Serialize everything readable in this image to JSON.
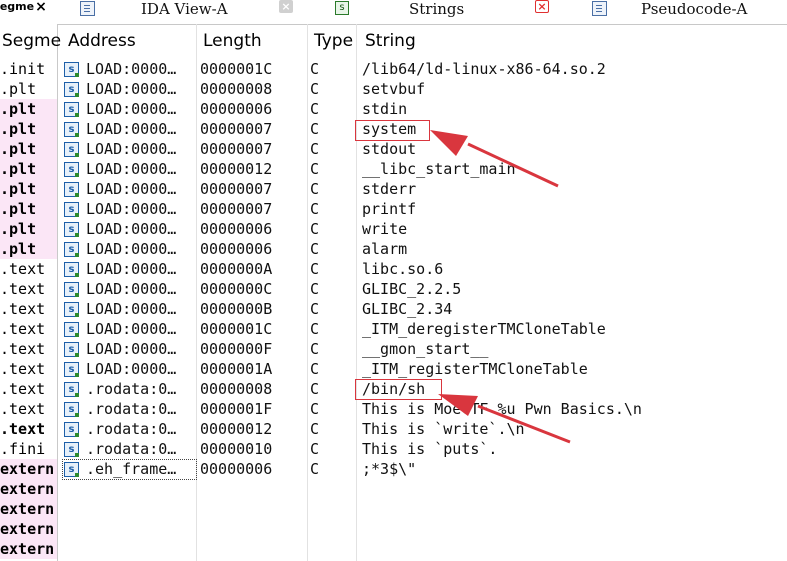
{
  "tabs": [
    {
      "label": "IDA View-A",
      "close": "×"
    },
    {
      "label": "Strings",
      "close": "×"
    },
    {
      "label": "Pseudocode-A",
      "close": ""
    }
  ],
  "left_close": "×",
  "segments_header": "Segme",
  "segments": [
    {
      "label": ".init",
      "hl": false,
      "bold": false
    },
    {
      "label": ".plt",
      "hl": false,
      "bold": false
    },
    {
      "label": ".plt",
      "hl": true,
      "bold": true
    },
    {
      "label": ".plt",
      "hl": true,
      "bold": true
    },
    {
      "label": ".plt",
      "hl": true,
      "bold": true
    },
    {
      "label": ".plt",
      "hl": true,
      "bold": true
    },
    {
      "label": ".plt",
      "hl": true,
      "bold": true
    },
    {
      "label": ".plt",
      "hl": true,
      "bold": true
    },
    {
      "label": ".plt",
      "hl": true,
      "bold": true
    },
    {
      "label": ".plt",
      "hl": true,
      "bold": true
    },
    {
      "label": ".text",
      "hl": false,
      "bold": false
    },
    {
      "label": ".text",
      "hl": false,
      "bold": false
    },
    {
      "label": ".text",
      "hl": false,
      "bold": false
    },
    {
      "label": ".text",
      "hl": false,
      "bold": false
    },
    {
      "label": ".text",
      "hl": false,
      "bold": false
    },
    {
      "label": ".text",
      "hl": false,
      "bold": false
    },
    {
      "label": ".text",
      "hl": false,
      "bold": false
    },
    {
      "label": ".text",
      "hl": false,
      "bold": false
    },
    {
      "label": ".text",
      "hl": false,
      "bold": true
    },
    {
      "label": ".fini",
      "hl": false,
      "bold": false
    },
    {
      "label": "extern",
      "hl": true,
      "bold": true
    },
    {
      "label": "extern",
      "hl": true,
      "bold": true
    },
    {
      "label": "extern",
      "hl": true,
      "bold": true
    },
    {
      "label": "extern",
      "hl": true,
      "bold": true
    },
    {
      "label": "extern",
      "hl": true,
      "bold": true
    }
  ],
  "columns": {
    "address": "Address",
    "length": "Length",
    "type": "Type",
    "string": "String"
  },
  "rows": [
    {
      "address": "LOAD:0000…",
      "length": "0000001C",
      "type": "C",
      "string": "/lib64/ld-linux-x86-64.so.2"
    },
    {
      "address": "LOAD:0000…",
      "length": "00000008",
      "type": "C",
      "string": "setvbuf"
    },
    {
      "address": "LOAD:0000…",
      "length": "00000006",
      "type": "C",
      "string": "stdin"
    },
    {
      "address": "LOAD:0000…",
      "length": "00000007",
      "type": "C",
      "string": "system"
    },
    {
      "address": "LOAD:0000…",
      "length": "00000007",
      "type": "C",
      "string": "stdout"
    },
    {
      "address": "LOAD:0000…",
      "length": "00000012",
      "type": "C",
      "string": "__libc_start_main"
    },
    {
      "address": "LOAD:0000…",
      "length": "00000007",
      "type": "C",
      "string": "stderr"
    },
    {
      "address": "LOAD:0000…",
      "length": "00000007",
      "type": "C",
      "string": "printf"
    },
    {
      "address": "LOAD:0000…",
      "length": "00000006",
      "type": "C",
      "string": "write"
    },
    {
      "address": "LOAD:0000…",
      "length": "00000006",
      "type": "C",
      "string": "alarm"
    },
    {
      "address": "LOAD:0000…",
      "length": "0000000A",
      "type": "C",
      "string": "libc.so.6"
    },
    {
      "address": "LOAD:0000…",
      "length": "0000000C",
      "type": "C",
      "string": "GLIBC_2.2.5"
    },
    {
      "address": "LOAD:0000…",
      "length": "0000000B",
      "type": "C",
      "string": "GLIBC_2.34"
    },
    {
      "address": "LOAD:0000…",
      "length": "0000001C",
      "type": "C",
      "string": "_ITM_deregisterTMCloneTable"
    },
    {
      "address": "LOAD:0000…",
      "length": "0000000F",
      "type": "C",
      "string": "__gmon_start__"
    },
    {
      "address": "LOAD:0000…",
      "length": "0000001A",
      "type": "C",
      "string": "_ITM_registerTMCloneTable"
    },
    {
      "address": ".rodata:0…",
      "length": "00000008",
      "type": "C",
      "string": "/bin/sh"
    },
    {
      "address": ".rodata:0…",
      "length": "0000001F",
      "type": "C",
      "string": "This is MoeCTF %u Pwn Basics.\\n"
    },
    {
      "address": ".rodata:0…",
      "length": "00000012",
      "type": "C",
      "string": "This is `write`.\\n"
    },
    {
      "address": ".rodata:0…",
      "length": "00000010",
      "type": "C",
      "string": "This is `puts`."
    },
    {
      "address": ".eh_frame…",
      "length": "00000006",
      "type": "C",
      "string": ";*3$\\\""
    }
  ],
  "string_icon_glyph": "s",
  "colors": {
    "annotation": "#d9363e",
    "segment_highlight": "#fbe6f6"
  }
}
